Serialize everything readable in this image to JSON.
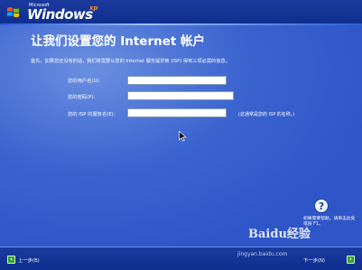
{
  "header": {
    "logo_small": "Microsoft",
    "logo_main": "Windows",
    "logo_suffix": "xp"
  },
  "page": {
    "title": "让我们设置您的 Internet 帐户",
    "intro": "首先，如果您还没有的话，我们将需要从您的 Internet 服务提供商 (ISP) 得到三项必需的信息。"
  },
  "form": {
    "fields": [
      {
        "label": "您的用户名(U):",
        "value": ""
      },
      {
        "label": "您的密码(P):",
        "value": ""
      },
      {
        "label": "您的 ISP 的服务名(E):",
        "value": ""
      }
    ],
    "isp_hint": "(这通常是您的 ISP 的名称。)"
  },
  "help": {
    "text": "如果需要帮助，请单击此处或按 F1。"
  },
  "footer": {
    "back_label": "上一步(B)",
    "next_label": "下一步(N)"
  },
  "watermark": {
    "brand": "Baidu经验",
    "url": "jingyan.baidu.com"
  },
  "colors": {
    "background": "#2f56c8",
    "bar": "#0f2f8f",
    "accent": "#9fc1ff",
    "nav_button": "#2ea02e"
  }
}
